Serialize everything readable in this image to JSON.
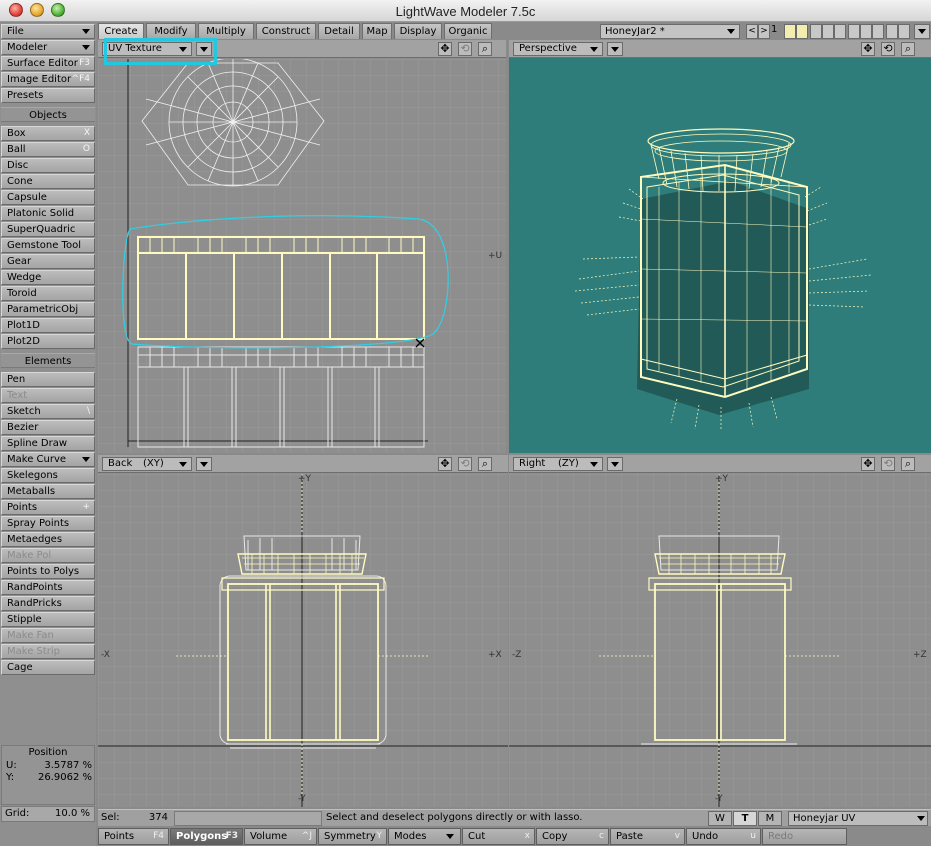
{
  "window": {
    "title": "LightWave Modeler 7.5c"
  },
  "sidebar": {
    "top_buttons": [
      {
        "label": "File",
        "shortcut": "",
        "dropdown": true
      },
      {
        "label": "Modeler",
        "shortcut": "",
        "dropdown": true
      },
      {
        "label": "Surface Editor",
        "shortcut": "F3"
      },
      {
        "label": "Image Editor",
        "shortcut": "^F4"
      },
      {
        "label": "Presets",
        "shortcut": ""
      }
    ],
    "objects_header": "Objects",
    "objects": [
      {
        "label": "Box",
        "shortcut": "X"
      },
      {
        "label": "Ball",
        "shortcut": "O"
      },
      {
        "label": "Disc",
        "shortcut": ""
      },
      {
        "label": "Cone",
        "shortcut": ""
      },
      {
        "label": "Capsule",
        "shortcut": ""
      },
      {
        "label": "Platonic Solid",
        "shortcut": ""
      },
      {
        "label": "SuperQuadric",
        "shortcut": ""
      },
      {
        "label": "Gemstone Tool",
        "shortcut": ""
      },
      {
        "label": "Gear",
        "shortcut": ""
      },
      {
        "label": "Wedge",
        "shortcut": ""
      },
      {
        "label": "Toroid",
        "shortcut": ""
      },
      {
        "label": "ParametricObj",
        "shortcut": ""
      },
      {
        "label": "Plot1D",
        "shortcut": ""
      },
      {
        "label": "Plot2D",
        "shortcut": ""
      }
    ],
    "elements_header": "Elements",
    "elements": [
      {
        "label": "Pen",
        "shortcut": "",
        "disabled": false
      },
      {
        "label": "Text",
        "shortcut": "",
        "disabled": true
      },
      {
        "label": "Sketch",
        "shortcut": "\\",
        "disabled": false
      },
      {
        "label": "Bezier",
        "shortcut": "",
        "disabled": false
      },
      {
        "label": "Spline Draw",
        "shortcut": "",
        "disabled": false
      },
      {
        "label": "Make Curve",
        "shortcut": "",
        "disabled": false,
        "dropdown": true
      },
      {
        "label": "Skelegons",
        "shortcut": "",
        "disabled": false
      },
      {
        "label": "Metaballs",
        "shortcut": "",
        "disabled": false
      },
      {
        "label": "Points",
        "shortcut": "+",
        "disabled": false
      },
      {
        "label": "Spray Points",
        "shortcut": "",
        "disabled": false
      },
      {
        "label": "Metaedges",
        "shortcut": "",
        "disabled": false
      },
      {
        "label": "Make Pol",
        "shortcut": "",
        "disabled": true
      },
      {
        "label": "Points to Polys",
        "shortcut": "",
        "disabled": false
      },
      {
        "label": "RandPoints",
        "shortcut": "",
        "disabled": false
      },
      {
        "label": "RandPricks",
        "shortcut": "",
        "disabled": false
      },
      {
        "label": "Stipple",
        "shortcut": "",
        "disabled": false
      },
      {
        "label": "Make Fan",
        "shortcut": "",
        "disabled": true
      },
      {
        "label": "Make Strip",
        "shortcut": "",
        "disabled": true
      },
      {
        "label": "Cage",
        "shortcut": "",
        "disabled": false
      }
    ],
    "position": {
      "title": "Position",
      "u_label": "U:",
      "u_value": "3.5787 %",
      "v_label": "Y:",
      "v_value": "26.9062 %"
    },
    "grid": {
      "label": "Grid:",
      "value": "10.0 %"
    }
  },
  "tabs": [
    {
      "label": "Create",
      "active": true
    },
    {
      "label": "Modify",
      "active": false
    },
    {
      "label": "Multiply",
      "active": false
    },
    {
      "label": "Construct",
      "active": false
    },
    {
      "label": "Detail",
      "active": false
    },
    {
      "label": "Map",
      "active": false
    },
    {
      "label": "Display",
      "active": false
    },
    {
      "label": "Organic",
      "active": false
    }
  ],
  "layer_bar": {
    "object_name": "HoneyJar2 *",
    "prev_label": "<",
    "next_label": ">",
    "layer_number": "1"
  },
  "viewports": {
    "top_left": {
      "view_label": "UV Texture",
      "axis_label": "+U"
    },
    "top_right": {
      "view_label": "Perspective"
    },
    "bottom_left": {
      "view_label": "Back",
      "axes_label": "(XY)",
      "pos_x": "+X",
      "neg_x": "-X",
      "pos_y": "+Y",
      "neg_y": "-Y"
    },
    "bottom_right": {
      "view_label": "Right",
      "axes_label": "(ZY)",
      "pos_z": "+Z",
      "neg_z": "-Z",
      "pos_y": "+Y",
      "neg_y": "-Y"
    }
  },
  "status": {
    "sel_label": "Sel:",
    "sel_value": "374",
    "hint": "Select and deselect polygons directly or with lasso.",
    "wtm": [
      {
        "label": "W",
        "on": false
      },
      {
        "label": "T",
        "on": true
      },
      {
        "label": "M",
        "on": false
      }
    ],
    "vmap": "Honeyjar UV"
  },
  "bottom_bar": [
    {
      "label": "Points",
      "shortcut": "F4",
      "active": false,
      "disabled": false
    },
    {
      "label": "Polygons",
      "shortcut": "F3",
      "active": true,
      "disabled": false
    },
    {
      "label": "Volume",
      "shortcut": "^J",
      "active": false,
      "disabled": false
    },
    {
      "label": "Symmetry",
      "shortcut": "Y",
      "active": false,
      "disabled": false
    },
    {
      "label": "Modes",
      "shortcut": "",
      "active": false,
      "disabled": false,
      "dropdown": true
    },
    {
      "label": "Cut",
      "shortcut": "x",
      "active": false,
      "disabled": false
    },
    {
      "label": "Copy",
      "shortcut": "c",
      "active": false,
      "disabled": false
    },
    {
      "label": "Paste",
      "shortcut": "v",
      "active": false,
      "disabled": false
    },
    {
      "label": "Undo",
      "shortcut": "u",
      "active": false,
      "disabled": false
    },
    {
      "label": "Redo",
      "shortcut": "",
      "active": false,
      "disabled": true
    }
  ],
  "colors": {
    "perspective_bg": "#2e7d7a",
    "wire_selected": "#fffbc0",
    "wire_unselected": "#e6e6e6",
    "highlight_cyan": "#23c8e0"
  }
}
